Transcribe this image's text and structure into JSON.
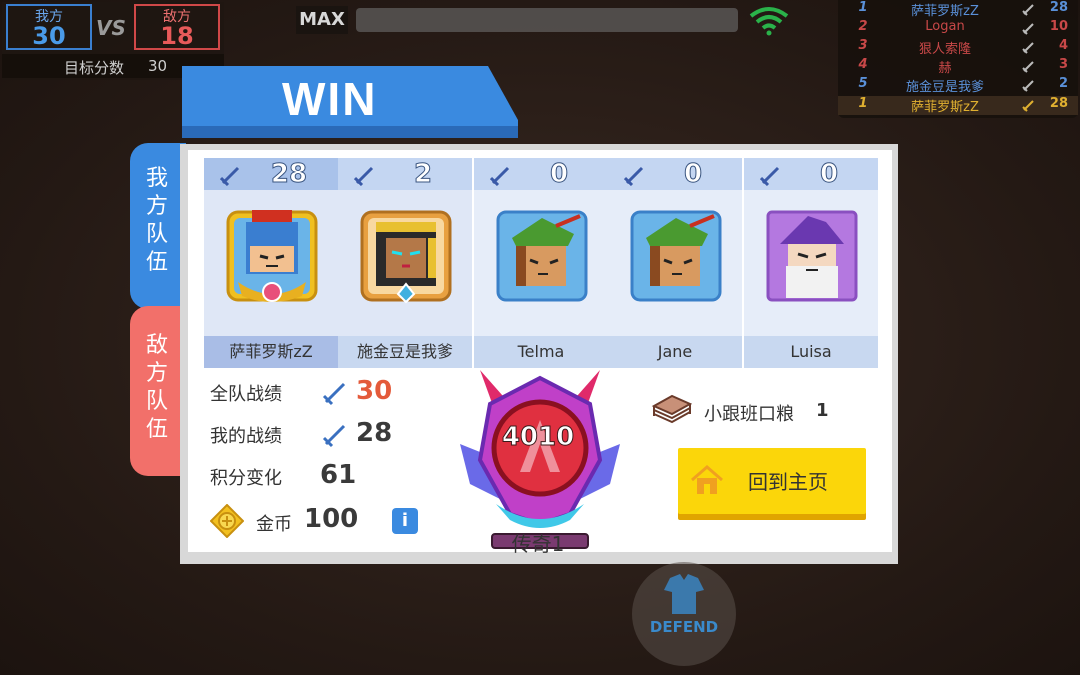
{
  "scoreboard": {
    "my_team_label": "我方",
    "my_team_score": "30",
    "vs_label": "VS",
    "enemy_team_label": "敌方",
    "enemy_team_score": "18",
    "target_label": "目标分数",
    "target_value": "30"
  },
  "topbar": {
    "max_label": "MAX",
    "wifi_icon": "wifi-icon"
  },
  "ranking": [
    {
      "rank": "1",
      "name": "萨菲罗斯zZ",
      "kills": "28",
      "team": "blue"
    },
    {
      "rank": "2",
      "name": "Logan",
      "kills": "10",
      "team": "red"
    },
    {
      "rank": "3",
      "name": "狠人索隆",
      "kills": "4",
      "team": "red"
    },
    {
      "rank": "4",
      "name": "赫",
      "kills": "3",
      "team": "red"
    },
    {
      "rank": "5",
      "name": "施金豆是我爹",
      "kills": "2",
      "team": "blue"
    },
    {
      "rank": "1",
      "name": "萨菲罗斯zZ",
      "kills": "28",
      "team": "self"
    }
  ],
  "result": {
    "title": "WIN"
  },
  "tabs": {
    "my_team": "我方队伍",
    "enemy_team": "敌方队伍"
  },
  "players": [
    {
      "name": "萨菲罗斯zZ",
      "kills": "28",
      "avatar": "knight-avatar"
    },
    {
      "name": "施金豆是我爹",
      "kills": "2",
      "avatar": "pharaoh-avatar"
    },
    {
      "name": "Telma",
      "kills": "0",
      "avatar": "archer-avatar"
    },
    {
      "name": "Jane",
      "kills": "0",
      "avatar": "archer-avatar"
    },
    {
      "name": "Luisa",
      "kills": "0",
      "avatar": "wizard-avatar"
    }
  ],
  "stats": {
    "team_record_label": "全队战绩",
    "team_record_value": "30",
    "my_record_label": "我的战绩",
    "my_record_value": "28",
    "points_change_label": "积分变化",
    "points_change_value": "61",
    "coins_label": "金币",
    "coins_value": "100",
    "info_label": "i"
  },
  "rank": {
    "score": "4010",
    "title": "传奇1"
  },
  "reward": {
    "label": "小跟班口粮",
    "count": "1"
  },
  "actions": {
    "home_label": "回到主页",
    "defend_label": "DEFEND"
  },
  "colors": {
    "blue_team": "#3a8ae0",
    "red_team": "#f2706a",
    "win_banner": "#3a8ae0",
    "home_button": "#fbd60a"
  }
}
